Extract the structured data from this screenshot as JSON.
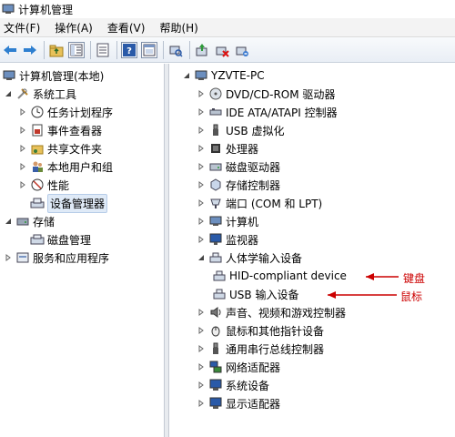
{
  "window": {
    "title": "计算机管理"
  },
  "menubar": {
    "items": [
      "文件(F)",
      "操作(A)",
      "查看(V)",
      "帮助(H)"
    ]
  },
  "toolbar": {
    "icons": [
      "back-arrow-icon",
      "forward-arrow-icon",
      "up-folder-icon",
      "show-tree-icon",
      "properties-icon",
      "help-icon",
      "view-pane-icon",
      "scan-hardware-icon",
      "update-driver-icon",
      "disable-device-icon",
      "uninstall-device-icon"
    ]
  },
  "left_tree": {
    "root": "计算机管理(本地)",
    "system_tools": "系统工具",
    "task_scheduler": "任务计划程序",
    "event_viewer": "事件查看器",
    "shared_folders": "共享文件夹",
    "local_users": "本地用户和组",
    "performance": "性能",
    "device_manager": "设备管理器",
    "storage": "存储",
    "disk_management": "磁盘管理",
    "services_apps": "服务和应用程序"
  },
  "right_tree": {
    "root": "YZVTE-PC",
    "categories": {
      "dvd": "DVD/CD-ROM 驱动器",
      "ide": "IDE ATA/ATAPI 控制器",
      "usb_virtual": "USB 虚拟化",
      "processor": "处理器",
      "disk": "磁盘驱动器",
      "storage_ctrl": "存储控制器",
      "ports": "端口 (COM 和 LPT)",
      "computer": "计算机",
      "monitor": "监视器",
      "hid": "人体学输入设备",
      "hid_compliant": "HID-compliant device",
      "usb_input": "USB 输入设备",
      "sound": "声音、视频和游戏控制器",
      "mice": "鼠标和其他指针设备",
      "usb_bus": "通用串行总线控制器",
      "network": "网络适配器",
      "system": "系统设备",
      "display": "显示适配器"
    }
  },
  "annotations": {
    "keyboard": "键盘",
    "mouse": "鼠标",
    "color": "#cc0000"
  }
}
